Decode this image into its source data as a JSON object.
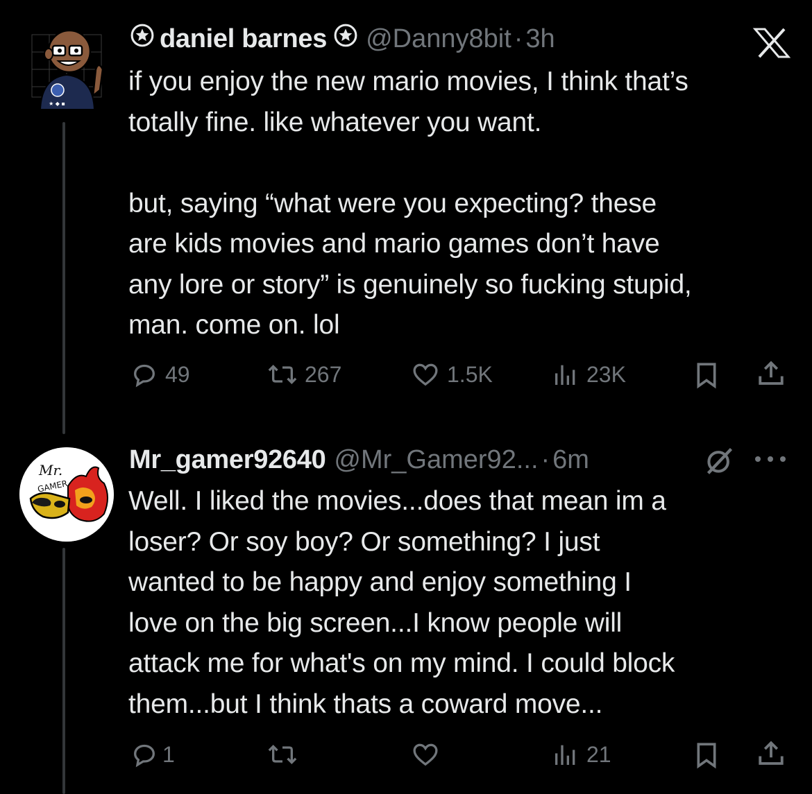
{
  "tweets": [
    {
      "display_name": "daniel barnes",
      "handle": "@Danny8bit",
      "separator": "·",
      "time": "3h",
      "text": "if you enjoy the new mario movies, I think that’s\ntotally fine. like whatever you want.\n\nbut, saying “what were you expecting? these\nare kids movies and mario games don’t have\nany lore or story” is genuinely so fucking stupid,\nman. come on. lol",
      "replies": "49",
      "reposts": "267",
      "likes": "1.5K",
      "views": "23K",
      "badge_icons": [
        "star-badge-icon",
        "star-badge-icon"
      ],
      "corner_icon": "x-logo-icon"
    },
    {
      "display_name": "Mr_gamer92640",
      "handle": "@Mr_Gamer92...",
      "separator": "·",
      "time": "6m",
      "text": "Well. I liked the movies...does that mean im a\nloser? Or soy boy? Or something? I just\nwanted to be happy and enjoy something I\nlove on the big screen...I know people will\nattack me for what's on my mind. I could block\nthem...but I think thats a coward move...",
      "replies": "1",
      "reposts": "",
      "likes": "",
      "views": "21",
      "corner_icons": [
        "grok-icon",
        "more-icon"
      ]
    }
  ],
  "colors": {
    "background": "#000000",
    "text": "#e7e9ea",
    "muted": "#71767b",
    "thread_line": "#333639"
  }
}
